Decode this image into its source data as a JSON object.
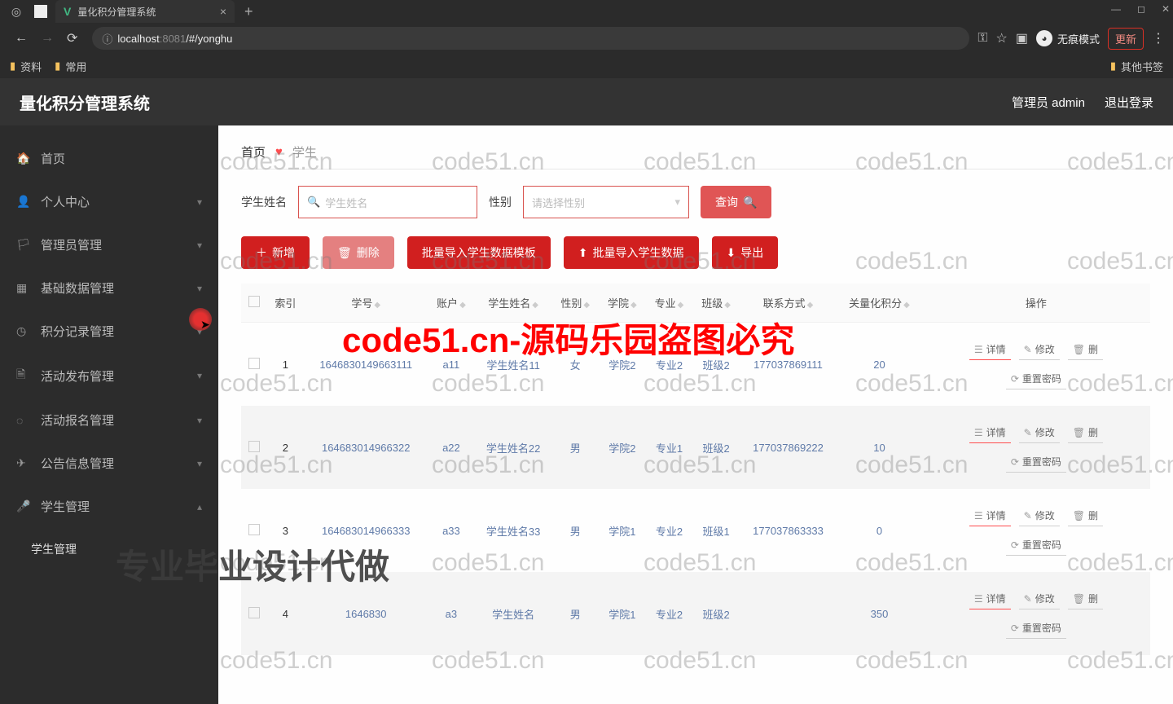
{
  "browser": {
    "tab_title": "量化积分管理系统",
    "url_host": "localhost",
    "url_port": ":8081",
    "url_path": "/#/yonghu",
    "incognito_label": "无痕模式",
    "update_label": "更新",
    "bookmarks": {
      "b1": "资料",
      "b2": "常用",
      "other": "其他书签"
    }
  },
  "header": {
    "title": "量化积分管理系统",
    "user": "管理员 admin",
    "logout": "退出登录"
  },
  "sidebar": {
    "home": "首页",
    "personal": "个人中心",
    "admin": "管理员管理",
    "base_data": "基础数据管理",
    "points": "积分记录管理",
    "activity_pub": "活动发布管理",
    "activity_enroll": "活动报名管理",
    "notice": "公告信息管理",
    "student": "学生管理",
    "student_sub": "学生管理"
  },
  "breadcrumb": {
    "home": "首页",
    "current": "学生"
  },
  "filters": {
    "name_label": "学生姓名",
    "name_placeholder": "学生姓名",
    "gender_label": "性别",
    "gender_placeholder": "请选择性别",
    "query": "查询"
  },
  "actions": {
    "add": "新增",
    "delete": "删除",
    "template": "批量导入学生数据模板",
    "import": "批量导入学生数据",
    "export": "导出"
  },
  "table": {
    "headers": {
      "index": "索引",
      "sid": "学号",
      "account": "账户",
      "name": "学生姓名",
      "gender": "性别",
      "college": "学院",
      "major": "专业",
      "class": "班级",
      "phone": "联系方式",
      "points": "关量化积分",
      "ops": "操作"
    },
    "op_labels": {
      "detail": "详情",
      "edit": "修改",
      "delete": "删",
      "reset": "重置密码"
    },
    "rows": [
      {
        "index": "1",
        "sid": "1646830149663111",
        "account": "a11",
        "name": "学生姓名11",
        "gender": "女",
        "college": "学院2",
        "major": "专业2",
        "class": "班级2",
        "phone": "177037869111",
        "points": "20"
      },
      {
        "index": "2",
        "sid": "164683014966322",
        "account": "a22",
        "name": "学生姓名22",
        "gender": "男",
        "college": "学院2",
        "major": "专业1",
        "class": "班级2",
        "phone": "177037869222",
        "points": "10"
      },
      {
        "index": "3",
        "sid": "164683014966333",
        "account": "a33",
        "name": "学生姓名33",
        "gender": "男",
        "college": "学院1",
        "major": "专业2",
        "class": "班级1",
        "phone": "177037863333",
        "points": "0"
      },
      {
        "index": "4",
        "sid": "1646830",
        "account": "a3",
        "name": "学生姓名",
        "gender": "男",
        "college": "学院1",
        "major": "专业2",
        "class": "班级2",
        "phone": "",
        "points": "350"
      }
    ]
  },
  "watermarks": {
    "wm": "code51.cn",
    "red": "code51.cn-源码乐园盗图必究",
    "dark": "专业毕业设计代做"
  }
}
